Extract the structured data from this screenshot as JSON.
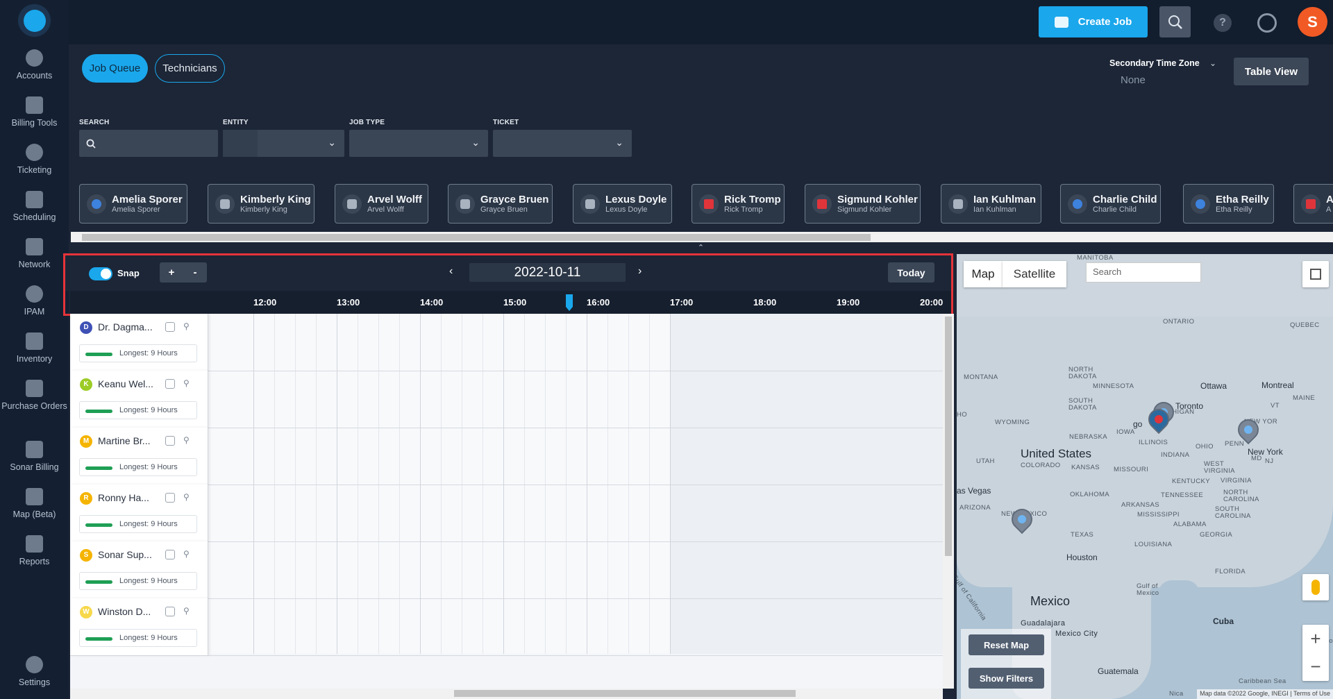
{
  "sidebar": {
    "items": [
      {
        "label": "Accounts",
        "icon": "user-icon"
      },
      {
        "label": "Billing Tools",
        "icon": "abacus-icon"
      },
      {
        "label": "Ticketing",
        "icon": "chat-icon"
      },
      {
        "label": "Scheduling",
        "icon": "calendar-icon"
      },
      {
        "label": "Network",
        "icon": "network-icon"
      },
      {
        "label": "IPAM",
        "icon": "ipam-icon"
      },
      {
        "label": "Inventory",
        "icon": "cart-icon"
      },
      {
        "label": "Purchase Orders",
        "icon": "clipboard-icon"
      },
      {
        "label": "Sonar Billing",
        "icon": "card-icon"
      },
      {
        "label": "Map (Beta)",
        "icon": "map-icon"
      },
      {
        "label": "Reports",
        "icon": "report-icon"
      }
    ],
    "settings_label": "Settings"
  },
  "topbar": {
    "create_job_label": "Create Job",
    "help_label": "?",
    "user_initial": "S"
  },
  "tabs": {
    "job_queue": "Job Queue",
    "technicians": "Technicians"
  },
  "timezone": {
    "label": "Secondary Time Zone",
    "value": "None"
  },
  "table_view_label": "Table View",
  "filters": {
    "search_label": "SEARCH",
    "entity_label": "ENTITY",
    "job_type_label": "JOB TYPE",
    "ticket_label": "TICKET"
  },
  "technician_chips": [
    {
      "name": "Amelia Sporer",
      "sub": "Amelia Sporer",
      "icon": "blue-dot"
    },
    {
      "name": "Kimberly King",
      "sub": "Kimberly King",
      "icon": "shirt"
    },
    {
      "name": "Arvel Wolff",
      "sub": "Arvel Wolff",
      "icon": "shirt"
    },
    {
      "name": "Grayce Bruen",
      "sub": "Grayce Bruen",
      "icon": "shirt"
    },
    {
      "name": "Lexus Doyle",
      "sub": "Lexus Doyle",
      "icon": "shirt"
    },
    {
      "name": "Rick Tromp",
      "sub": "Rick Tromp",
      "icon": "red-square"
    },
    {
      "name": "Sigmund Kohler",
      "sub": "Sigmund Kohler",
      "icon": "red-square"
    },
    {
      "name": "Ian Kuhlman",
      "sub": "Ian Kuhlman",
      "icon": "shirt"
    },
    {
      "name": "Charlie Child",
      "sub": "Charlie Child",
      "icon": "blue-dot"
    },
    {
      "name": "Etha Reilly",
      "sub": "Etha Reilly",
      "icon": "blue-dot"
    },
    {
      "name": "A",
      "sub": "A",
      "icon": "red-square"
    }
  ],
  "schedule": {
    "snap_label": "Snap",
    "zoom_in": "+",
    "zoom_out": "-",
    "prev": "‹",
    "next": "›",
    "date": "2022-10-11",
    "today_label": "Today",
    "hours": [
      "12:00",
      "13:00",
      "14:00",
      "15:00",
      "16:00",
      "17:00",
      "18:00",
      "19:00",
      "20:00"
    ],
    "technicians": [
      {
        "initial": "D",
        "name": "Dr. Dagma...",
        "color": "#3f51b5",
        "longest": "Longest: 9 Hours"
      },
      {
        "initial": "K",
        "name": "Keanu Wel...",
        "color": "#9ccc26",
        "longest": "Longest: 9 Hours"
      },
      {
        "initial": "M",
        "name": "Martine Br...",
        "color": "#f5b400",
        "longest": "Longest: 9 Hours"
      },
      {
        "initial": "R",
        "name": "Ronny Ha...",
        "color": "#f5b400",
        "longest": "Longest: 9 Hours"
      },
      {
        "initial": "S",
        "name": "Sonar Sup...",
        "color": "#f5b400",
        "longest": "Longest: 9 Hours"
      },
      {
        "initial": "W",
        "name": "Winston D...",
        "color": "#f7d84a",
        "longest": "Longest: 9 Hours"
      }
    ]
  },
  "map": {
    "map_tab": "Map",
    "satellite_tab": "Satellite",
    "search_placeholder": "Search",
    "reset_label": "Reset Map",
    "filters_label": "Show Filters",
    "zoom_in": "+",
    "zoom_out": "−",
    "attribution": "Map data ©2022 Google, INEGI | Terms of Use",
    "labels": {
      "manitoba": "MANITOBA",
      "ontario": "ONTARIO",
      "quebec": "QUEBEC",
      "north_dakota": "NORTH DAKOTA",
      "montana": "MONTANA",
      "minnesota": "MINNESOTA",
      "south_dakota": "SOUTH DAKOTA",
      "wyoming": "WYOMING",
      "nebraska": "NEBRASKA",
      "iowa": "IOWA",
      "illinois": "ILLINOIS",
      "michigan": "ICHIGAN",
      "ohio": "OHIO",
      "penn": "PENN",
      "utah": "UTAH",
      "colorado": "COLORADO",
      "kansas": "KANSAS",
      "missouri": "MISSOURI",
      "indiana": "INDIANA",
      "west_virginia": "WEST VIRGINIA",
      "virginia": "VIRGINIA",
      "kentucky": "KENTUCKY",
      "north_carolina": "NORTH CAROLINA",
      "south_carolina": "SOUTH CAROLINA",
      "tennessee": "TENNESSEE",
      "oklahoma": "OKLAHOMA",
      "arkansas": "ARKANSAS",
      "mississippi": "MISSISSIPPI",
      "alabama": "ALABAMA",
      "georgia": "GEORGIA",
      "arizona": "ARIZONA",
      "new_mexico": "NEW MEXICO",
      "texas": "TEXAS",
      "louisiana": "LOUISIANA",
      "florida": "FLORIDA",
      "maine": "MAINE",
      "vt": "VT",
      "new_york_state": "NEW YOR",
      "md": "MD",
      "nj": "NJ",
      "united_states": "United States",
      "mexico": "Mexico",
      "cuba": "Cuba",
      "guatemala": "Guatemala",
      "ottawa": "Ottawa",
      "montreal": "Montreal",
      "toronto": "Toronto",
      "new_york": "New York",
      "chicago": "go",
      "las_vegas": "as Vegas",
      "houston": "Houston",
      "guadalajara": "Guadalajara",
      "mexico_city": "Mexico City",
      "gulf_mexico": "Gulf of Mexico",
      "gulf_california": "Gulf of California",
      "caribbean": "Caribbean Sea",
      "ho": "HO",
      "do": "Do",
      "nica": "Nica"
    }
  }
}
